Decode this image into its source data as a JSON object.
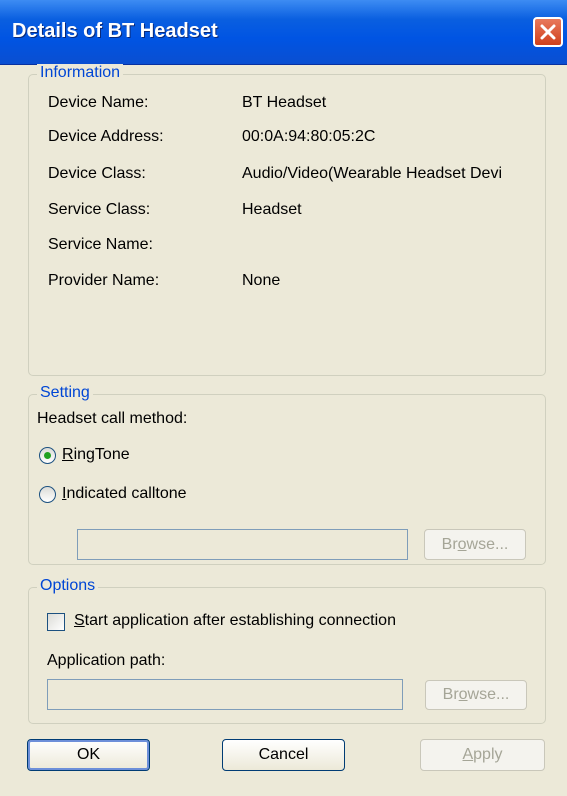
{
  "window": {
    "title": "Details of BT Headset"
  },
  "information": {
    "legend": "Information",
    "rows": [
      {
        "label": "Device Name:",
        "value": "BT Headset"
      },
      {
        "label": "Device Address:",
        "value": "00:0A:94:80:05:2C"
      },
      {
        "label": "Device Class:",
        "value": "Audio/Video(Wearable Headset Devi"
      },
      {
        "label": "Service Class:",
        "value": "Headset"
      },
      {
        "label": "Service Name:",
        "value": ""
      },
      {
        "label": "Provider Name:",
        "value": "None"
      }
    ]
  },
  "setting": {
    "legend": "Setting",
    "call_method_label": "Headset call method:",
    "ringtone": {
      "first": "R",
      "rest": "ingTone",
      "selected": true
    },
    "indicated": {
      "first": "I",
      "rest": "ndicated calltone",
      "selected": false
    },
    "path_value": "",
    "browse": {
      "before": "Br",
      "key": "o",
      "after": "wse..."
    }
  },
  "options": {
    "legend": "Options",
    "start_app": {
      "first": "S",
      "rest": "tart application after establishing connection",
      "checked": false
    },
    "app_path_label": "Application path:",
    "path_value": "",
    "browse": {
      "before": "Br",
      "key": "o",
      "after": "wse..."
    }
  },
  "buttons": {
    "ok": "OK",
    "cancel": "Cancel",
    "apply_key": "A",
    "apply_rest": "pply"
  }
}
